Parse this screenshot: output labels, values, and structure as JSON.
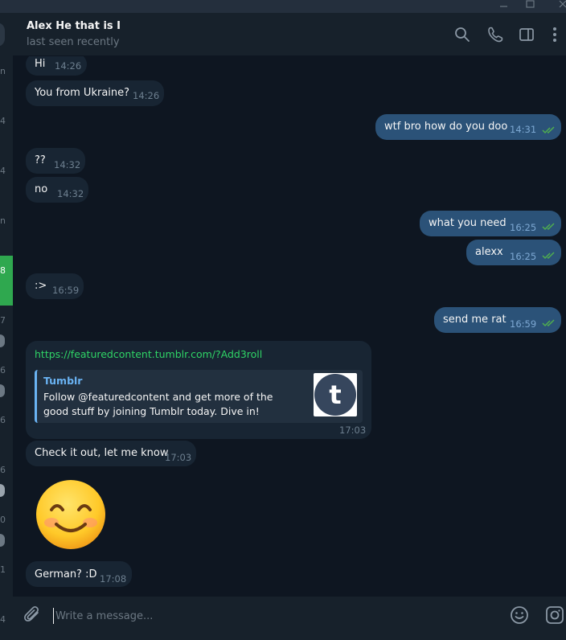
{
  "contact": {
    "name": "Alex He that is I",
    "status": "last seen recently"
  },
  "left_strip": {
    "labels": [
      "n",
      "4",
      "4",
      "n",
      "8",
      "7",
      "6",
      "6",
      "6",
      "0",
      "1",
      "4"
    ]
  },
  "messages": [
    {
      "dir": "in",
      "text": "Hi",
      "time": "14:26"
    },
    {
      "dir": "in",
      "text": "You from Ukraine?",
      "time": "14:26"
    },
    {
      "dir": "out",
      "text": "wtf bro how do you doo",
      "time": "14:31",
      "read": true
    },
    {
      "dir": "in",
      "text": "??",
      "time": "14:32"
    },
    {
      "dir": "in",
      "text": "no",
      "time": "14:32"
    },
    {
      "dir": "out",
      "text": "what you need",
      "time": "16:25",
      "read": true
    },
    {
      "dir": "out",
      "text": "alexx",
      "time": "16:25",
      "read": true
    },
    {
      "dir": "in",
      "text": ":>",
      "time": "16:59"
    },
    {
      "dir": "out",
      "text": "send me rat",
      "time": "16:59",
      "read": true
    }
  ],
  "link_message": {
    "url": "https://featuredcontent.tumblr.com/?Add3roll",
    "preview_site": "Tumblr",
    "preview_text": "Follow @featuredcontent and get more of the good stuff by joining Tumblr today. Dive in!",
    "preview_thumb_letter": "t",
    "time": "17:03"
  },
  "after_link": [
    {
      "dir": "in",
      "text": "Check it out, let me know",
      "time": "17:03"
    }
  ],
  "sticker": {
    "icon": "smiling-face-emoji"
  },
  "last": [
    {
      "dir": "in",
      "text": "German? :D",
      "time": "17:08"
    }
  ],
  "composer": {
    "placeholder": "Write a message...",
    "value": ""
  },
  "icons": {
    "search": "search-icon",
    "call": "phone-icon",
    "sidebar": "sidebar-toggle-icon",
    "more": "more-vertical-icon",
    "attach": "paperclip-icon",
    "emoji": "emoji-icon",
    "camera": "instagram-camera-icon"
  },
  "colors": {
    "background": "#0e1621",
    "incoming_bubble": "#182533",
    "outgoing_bubble": "#2b5278",
    "link": "#2fd466",
    "preview_accent": "#6ab3f3",
    "read_check": "#4fae4e",
    "active_chat": "#2fa84f"
  }
}
